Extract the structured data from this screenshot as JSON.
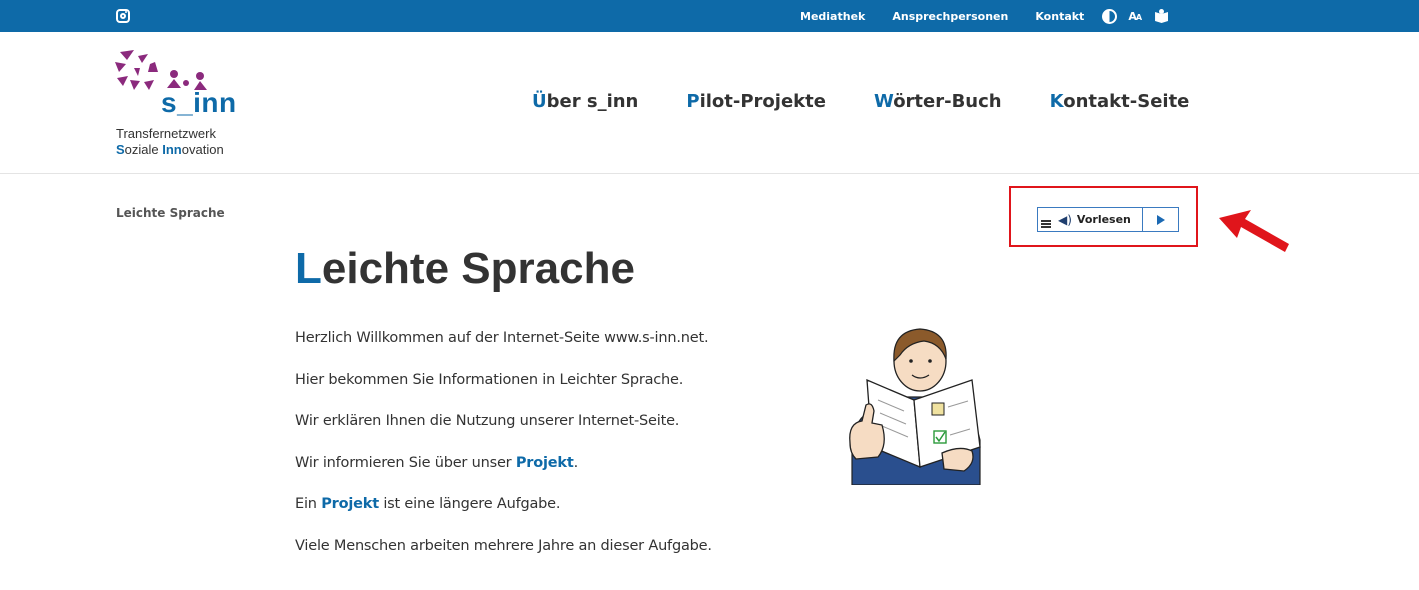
{
  "topbar": {
    "social_icon": "instagram-icon",
    "links": [
      "Mediathek",
      "Ansprechpersonen",
      "Kontakt"
    ],
    "icons": [
      "contrast-icon",
      "font-size-icon",
      "easy-read-icon"
    ],
    "fontsize_big": "A",
    "fontsize_small": "A",
    "bg_color": "#0e6aa8"
  },
  "logo": {
    "name": "s_inn",
    "line1": "Transfernetzwerk",
    "line2_parts": [
      "S",
      "oziale ",
      "Inn",
      "ovation"
    ],
    "colors": {
      "brand_blue": "#0e6aa8",
      "brand_purple": "#8b2a7d"
    }
  },
  "nav": {
    "items": [
      {
        "first": "Ü",
        "rest": "ber s_inn"
      },
      {
        "first": "P",
        "rest": "ilot-Projekte"
      },
      {
        "first": "W",
        "rest": "örter-Buch"
      },
      {
        "first": "K",
        "rest": "ontakt-Seite"
      }
    ]
  },
  "breadcrumb": "Leichte Sprache",
  "readspeaker": {
    "label": "Vorlesen",
    "icons": [
      "menu-icon",
      "speaker-icon",
      "play-icon"
    ]
  },
  "annotation": {
    "box_color": "#e0151b",
    "arrow_color": "#e0151b"
  },
  "title": {
    "first": "L",
    "rest": "eichte Sprache"
  },
  "paragraphs": {
    "p1": "Herzlich Willkommen auf der Internet-Seite www.s-inn.net.",
    "p2": "Hier bekommen Sie Informationen in Leichter Sprache.",
    "p3": "Wir erklären Ihnen die Nutzung unserer Internet-Seite.",
    "p4_before": "Wir informieren Sie über unser ",
    "p4_bold": "Projekt",
    "p4_after": ".",
    "p5_before": "Ein ",
    "p5_bold": "Projekt",
    "p5_after": " ist eine längere Aufgabe.",
    "p6": "Viele Menschen arbeiten mehrere Jahre an dieser Aufgabe."
  }
}
